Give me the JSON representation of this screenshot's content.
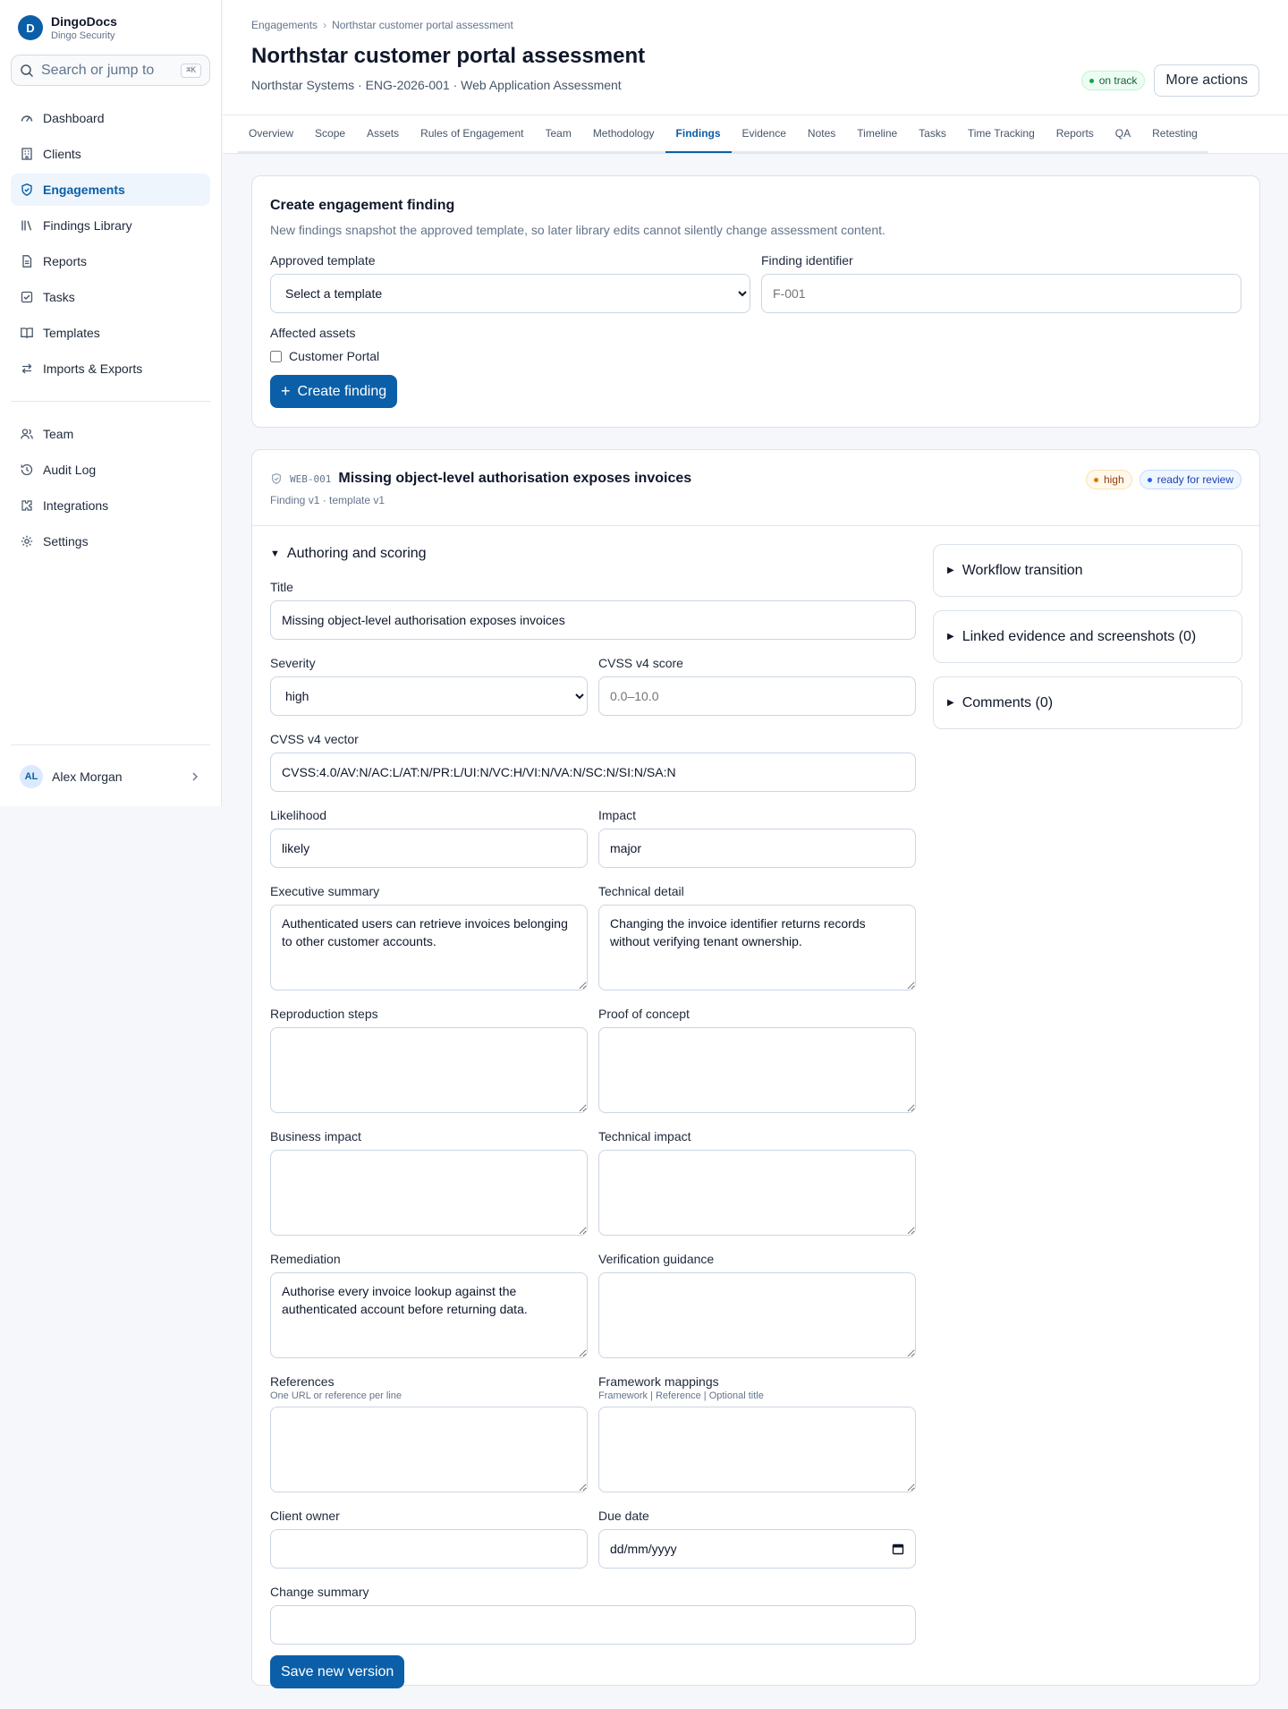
{
  "brand": {
    "initial": "D",
    "name": "DingoDocs",
    "org": "Dingo Security"
  },
  "search": {
    "placeholder": "Search or jump to",
    "shortcut": "⌘K"
  },
  "nav": {
    "items": [
      {
        "label": "Dashboard",
        "icon": "gauge-icon"
      },
      {
        "label": "Clients",
        "icon": "building-icon"
      },
      {
        "label": "Engagements",
        "icon": "shield-icon",
        "active": true
      },
      {
        "label": "Findings Library",
        "icon": "library-icon"
      },
      {
        "label": "Reports",
        "icon": "report-icon"
      },
      {
        "label": "Tasks",
        "icon": "checkbox-icon"
      },
      {
        "label": "Templates",
        "icon": "book-icon"
      },
      {
        "label": "Imports & Exports",
        "icon": "arrows-icon"
      }
    ],
    "secondary": [
      {
        "label": "Team",
        "icon": "users-icon"
      },
      {
        "label": "Audit Log",
        "icon": "history-icon"
      },
      {
        "label": "Integrations",
        "icon": "puzzle-icon"
      },
      {
        "label": "Settings",
        "icon": "gear-icon"
      }
    ]
  },
  "user": {
    "initials": "AL",
    "name": "Alex Morgan"
  },
  "breadcrumb": [
    "Engagements",
    "Northstar customer portal assessment"
  ],
  "page": {
    "title": "Northstar customer portal assessment",
    "subtitle": "Northstar Systems · ENG-2026-001 · Web Application Assessment",
    "status": "on track",
    "more_actions": "More actions"
  },
  "tabs": [
    "Overview",
    "Scope",
    "Assets",
    "Rules of Engagement",
    "Team",
    "Methodology",
    "Findings",
    "Evidence",
    "Notes",
    "Timeline",
    "Tasks",
    "Time Tracking",
    "Reports",
    "QA",
    "Retesting"
  ],
  "active_tab": "Findings",
  "create": {
    "title": "Create engagement finding",
    "description": "New findings snapshot the approved template, so later library edits cannot silently change assessment content.",
    "template_label": "Approved template",
    "template_value": "Select a template",
    "identifier_label": "Finding identifier",
    "identifier_placeholder": "F-001",
    "assets_label": "Affected assets",
    "asset_option": "Customer Portal",
    "button": "Create finding"
  },
  "finding": {
    "id": "WEB-001",
    "title": "Missing object-level authorisation exposes invoices",
    "version": "Finding v1 · template v1",
    "severity_badge": "high",
    "status_badge": "ready for review",
    "section": "Authoring and scoring",
    "fields": {
      "title_label": "Title",
      "title_value": "Missing object-level authorisation exposes invoices",
      "severity_label": "Severity",
      "severity_value": "high",
      "cvss_score_label": "CVSS v4 score",
      "cvss_score_placeholder": "0.0–10.0",
      "cvss_vector_label": "CVSS v4 vector",
      "cvss_vector_value": "CVSS:4.0/AV:N/AC:L/AT:N/PR:L/UI:N/VC:H/VI:N/VA:N/SC:N/SI:N/SA:N",
      "likelihood_label": "Likelihood",
      "likelihood_value": "likely",
      "impact_label": "Impact",
      "impact_value": "major",
      "exec_summary_label": "Executive summary",
      "exec_summary_value": "Authenticated users can retrieve invoices belonging to other customer accounts.",
      "tech_detail_label": "Technical detail",
      "tech_detail_value": "Changing the invoice identifier returns records without verifying tenant ownership.",
      "repro_label": "Reproduction steps",
      "poc_label": "Proof of concept",
      "business_impact_label": "Business impact",
      "technical_impact_label": "Technical impact",
      "remediation_label": "Remediation",
      "remediation_value": "Authorise every invoice lookup against the authenticated account before returning data.",
      "verification_label": "Verification guidance",
      "references_label": "References",
      "references_hint": "One URL or reference per line",
      "framework_label": "Framework mappings",
      "framework_hint": "Framework | Reference | Optional title",
      "owner_label": "Client owner",
      "due_label": "Due date",
      "due_placeholder": "dd/mm/yyyy",
      "change_label": "Change summary"
    },
    "save_button": "Save new version",
    "panels": [
      "Workflow transition",
      "Linked evidence and screenshots (0)",
      "Comments (0)"
    ]
  }
}
